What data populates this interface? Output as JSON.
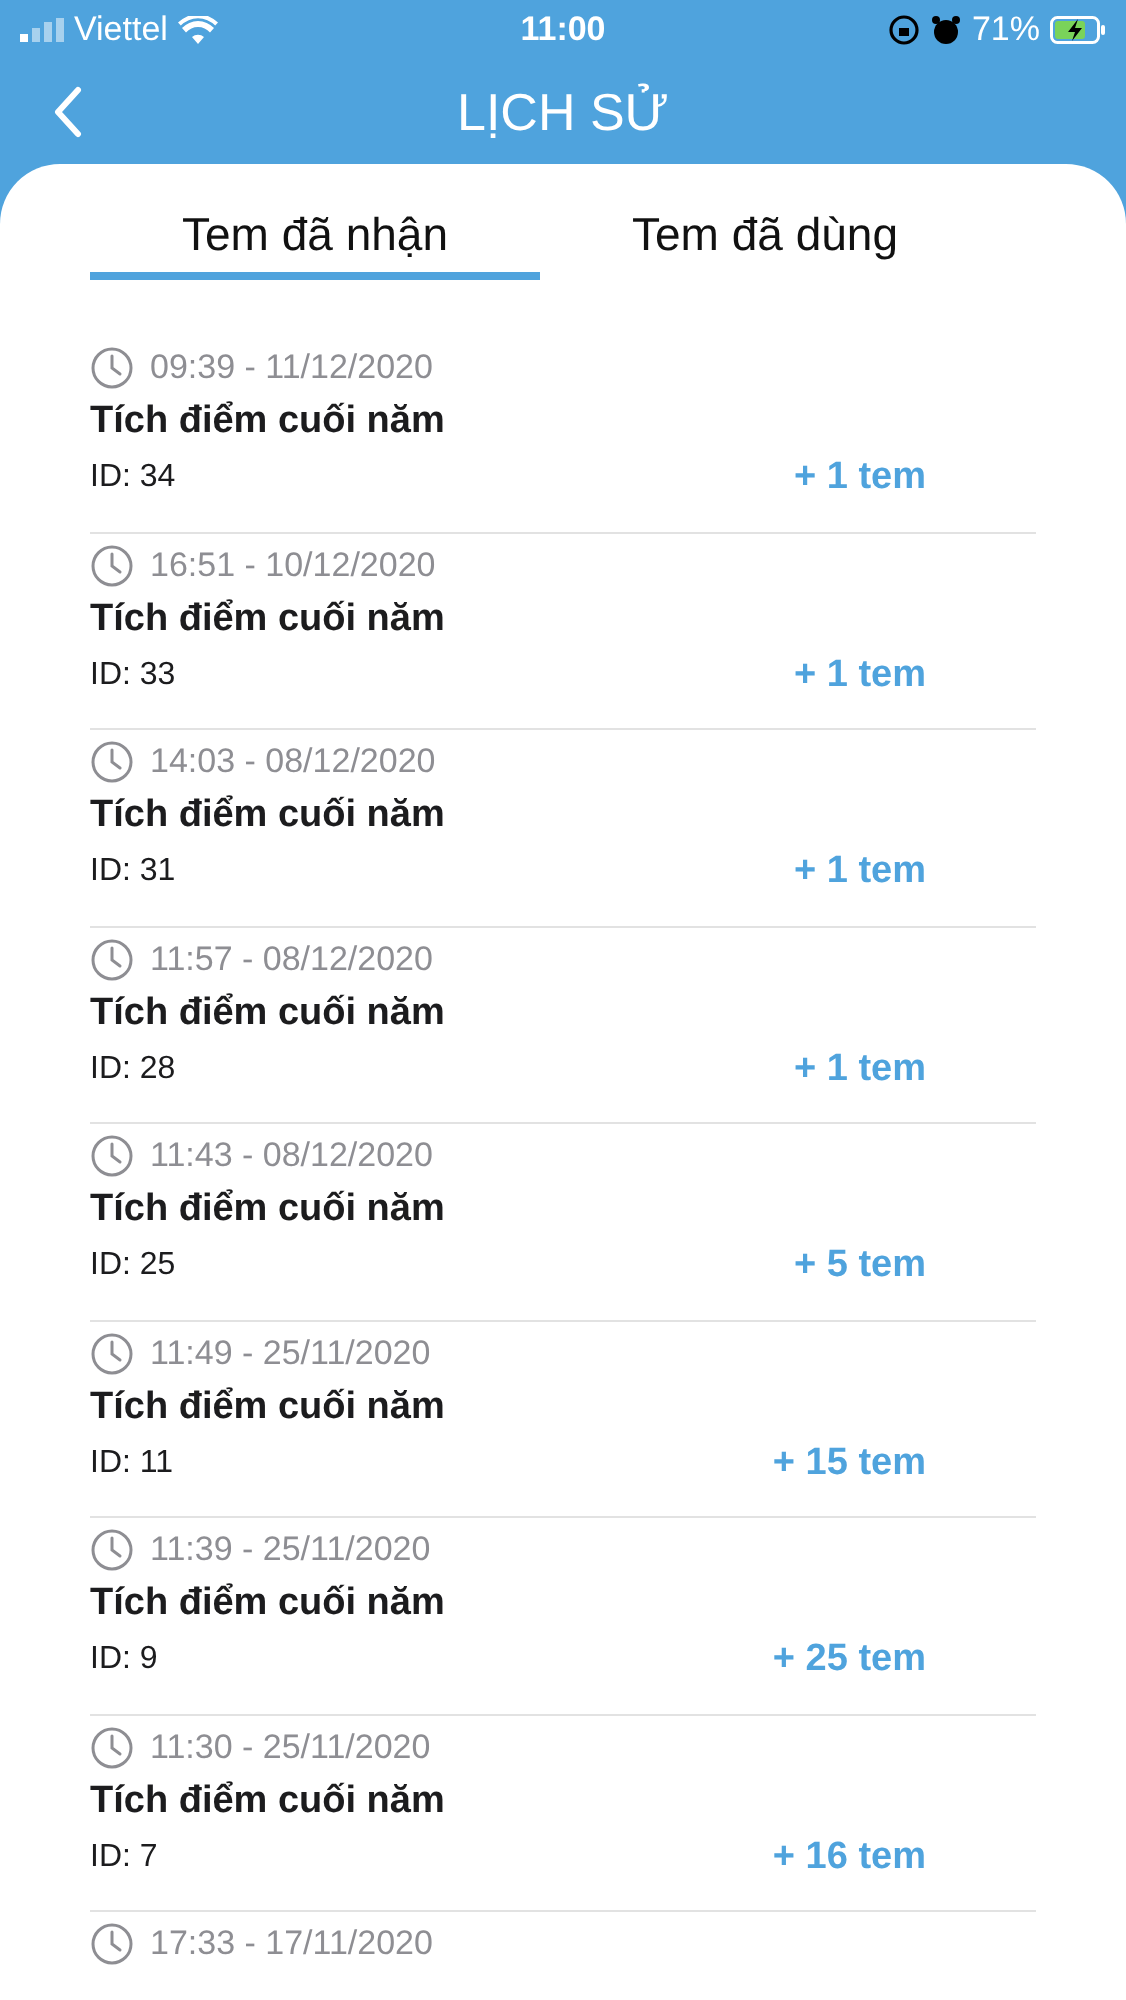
{
  "status_bar": {
    "carrier": "Viettel",
    "time": "11:00",
    "battery": "71%"
  },
  "header": {
    "title": "LỊCH SỬ"
  },
  "tabs": [
    {
      "label": "Tem đã nhận",
      "selected": true
    },
    {
      "label": "Tem đã dùng",
      "selected": false
    }
  ],
  "history": [
    {
      "time": "09:39 - 11/12/2020",
      "title": "Tích điểm cuối năm",
      "id": "ID: 34",
      "amount": "+ 1 tem"
    },
    {
      "time": "16:51 - 10/12/2020",
      "title": "Tích điểm cuối năm",
      "id": "ID: 33",
      "amount": "+ 1 tem"
    },
    {
      "time": "14:03 - 08/12/2020",
      "title": "Tích điểm cuối năm",
      "id": "ID: 31",
      "amount": "+ 1 tem"
    },
    {
      "time": "11:57 - 08/12/2020",
      "title": "Tích điểm cuối năm",
      "id": "ID: 28",
      "amount": "+ 1 tem"
    },
    {
      "time": "11:43 - 08/12/2020",
      "title": "Tích điểm cuối năm",
      "id": "ID: 25",
      "amount": "+ 5 tem"
    },
    {
      "time": "11:49 - 25/11/2020",
      "title": "Tích điểm cuối năm",
      "id": "ID: 11",
      "amount": "+ 15 tem"
    },
    {
      "time": "11:39 - 25/11/2020",
      "title": "Tích điểm cuối năm",
      "id": "ID: 9",
      "amount": "+ 25 tem"
    },
    {
      "time": "11:30 - 25/11/2020",
      "title": "Tích điểm cuối năm",
      "id": "ID: 7",
      "amount": "+ 16 tem"
    },
    {
      "time": "17:33 - 17/11/2020"
    }
  ]
}
